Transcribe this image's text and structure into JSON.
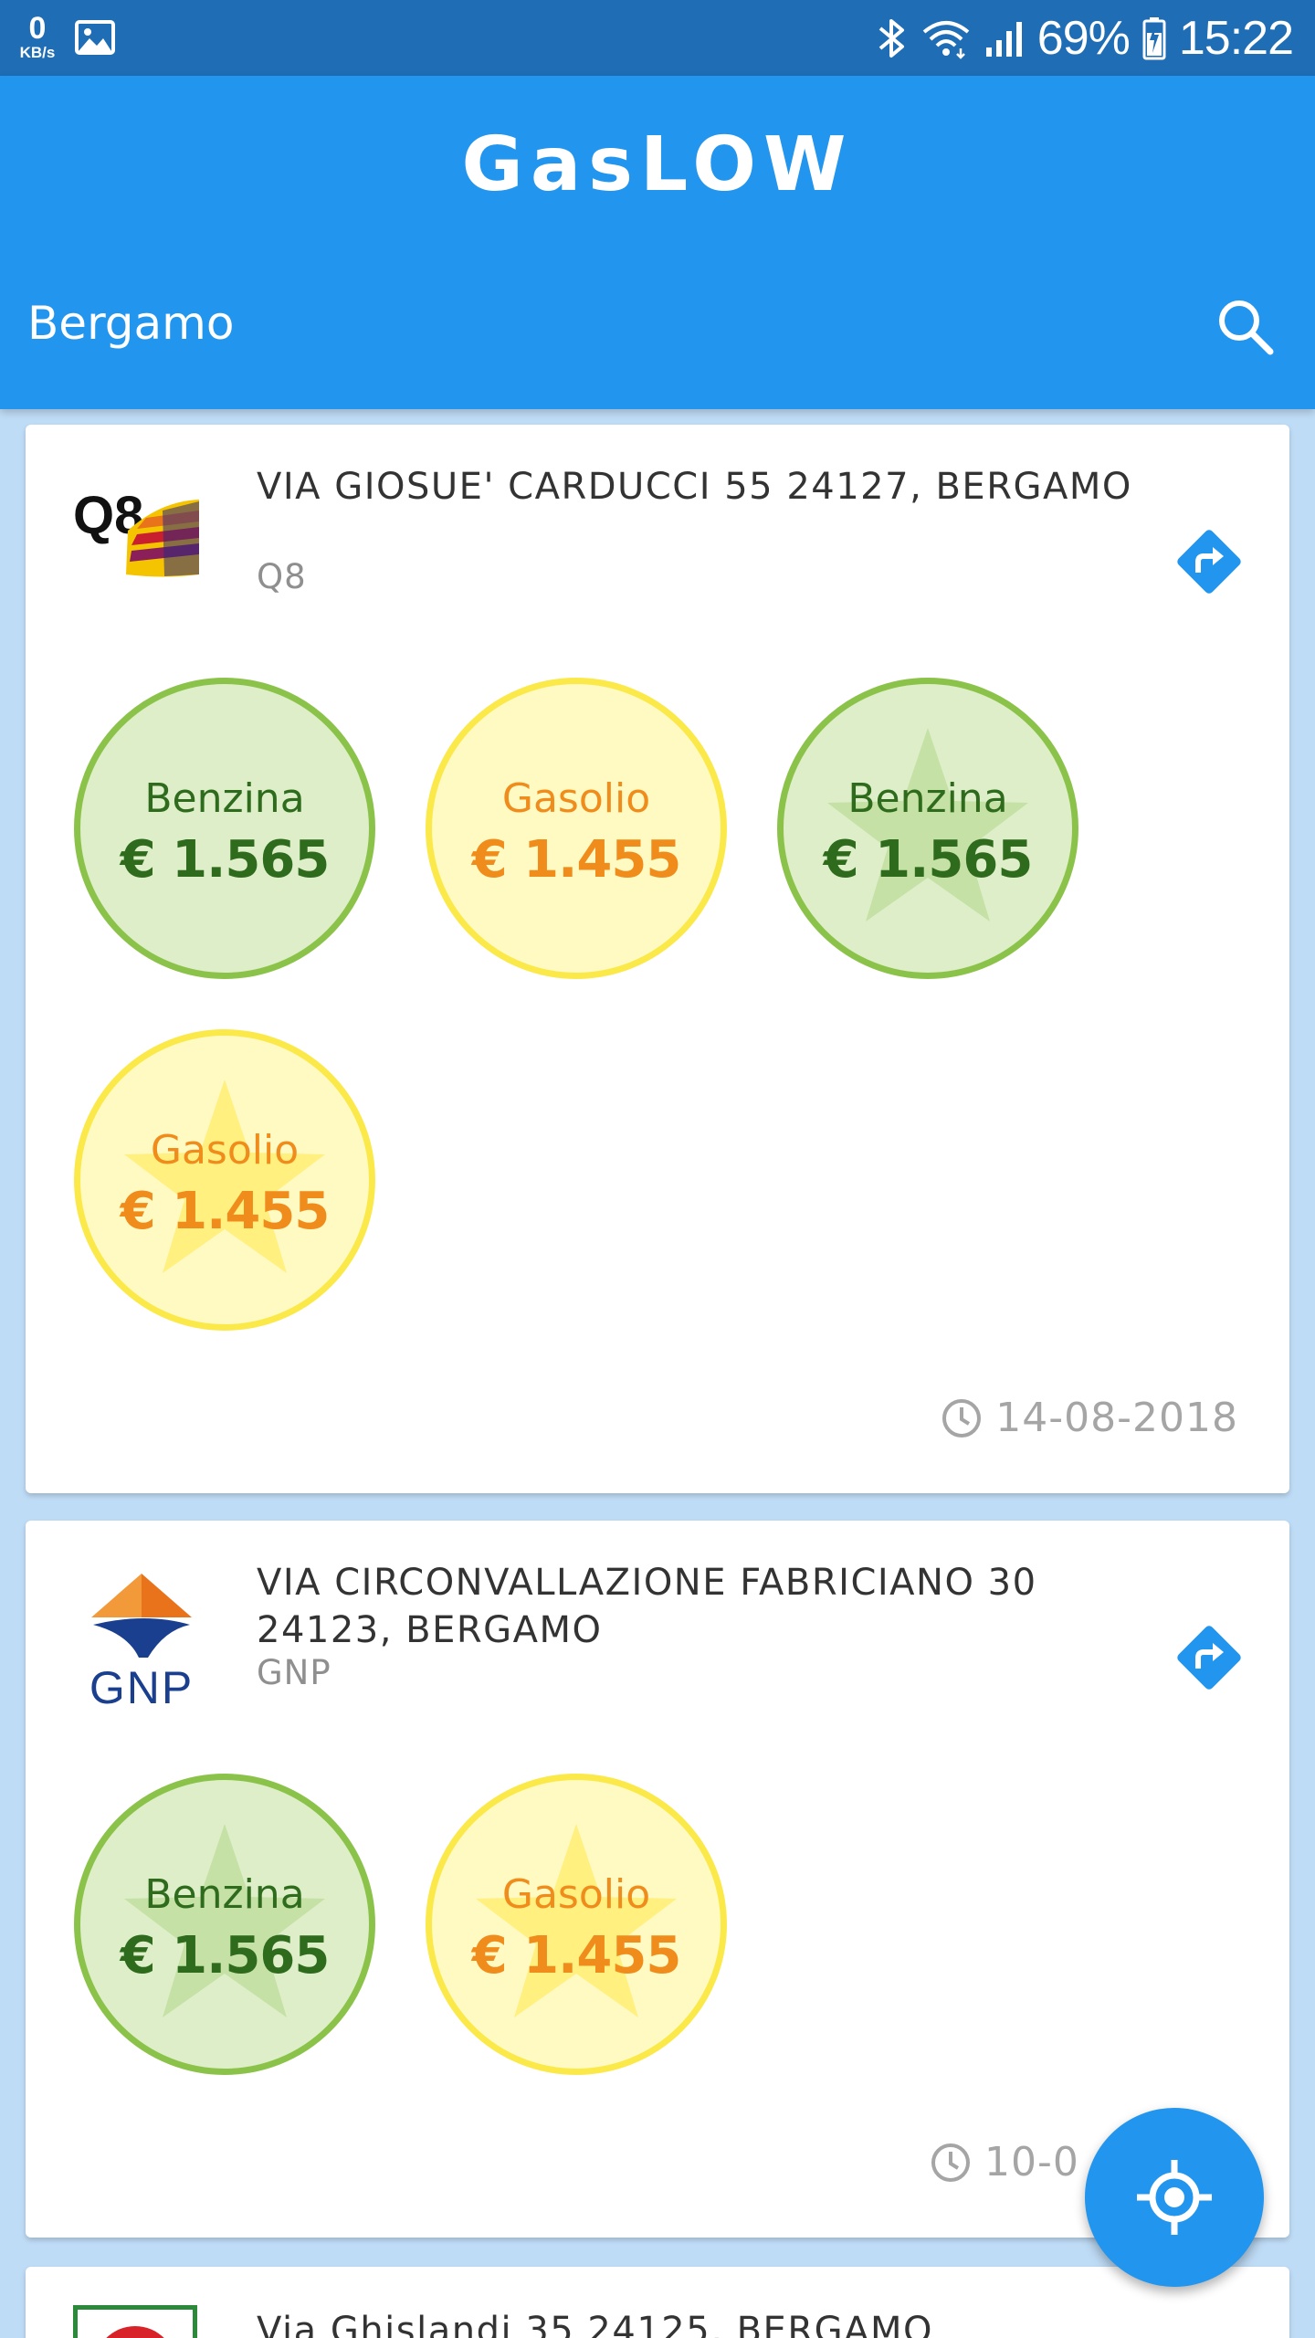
{
  "status_bar": {
    "net_speed_value": "0",
    "net_speed_unit": "KB/s",
    "battery": "69%",
    "time": "15:22",
    "icons": [
      "image-icon",
      "bluetooth-icon",
      "wifi-icon",
      "signal-icon",
      "battery-icon"
    ]
  },
  "app": {
    "title": "GasLOW",
    "location": "Bergamo",
    "colors": {
      "primary": "#2295ee",
      "status_bar": "#1e6db5",
      "green": "#8bc34a",
      "yellow": "#fbe94a",
      "orange_text": "#f08c1c",
      "green_text": "#2e6b1c"
    }
  },
  "stations": [
    {
      "logo": "Q8",
      "address": "VIA GIOSUE' CARDUCCI  55 24127, BERGAMO",
      "brand": "Q8",
      "prices": [
        {
          "label": "Benzina",
          "price": "€ 1.565",
          "color": "green",
          "star": false
        },
        {
          "label": "Gasolio",
          "price": "€ 1.455",
          "color": "yellow",
          "star": false
        },
        {
          "label": "Benzina",
          "price": "€ 1.565",
          "color": "green",
          "star": true
        },
        {
          "label": "Gasolio",
          "price": "€ 1.455",
          "color": "yellow",
          "star": true
        }
      ],
      "updated": "14-08-2018"
    },
    {
      "logo": "GNP",
      "address": "VIA CIRCONVALLAZIONE FABRICIANO 30 24123, BERGAMO",
      "brand": "GNP",
      "prices": [
        {
          "label": "Benzina",
          "price": "€ 1.565",
          "color": "green",
          "star": true
        },
        {
          "label": "Gasolio",
          "price": "€ 1.455",
          "color": "yellow",
          "star": true
        }
      ],
      "updated": "10-0"
    },
    {
      "address": "Via Ghislandi 35 24125, BERGAMO"
    }
  ]
}
